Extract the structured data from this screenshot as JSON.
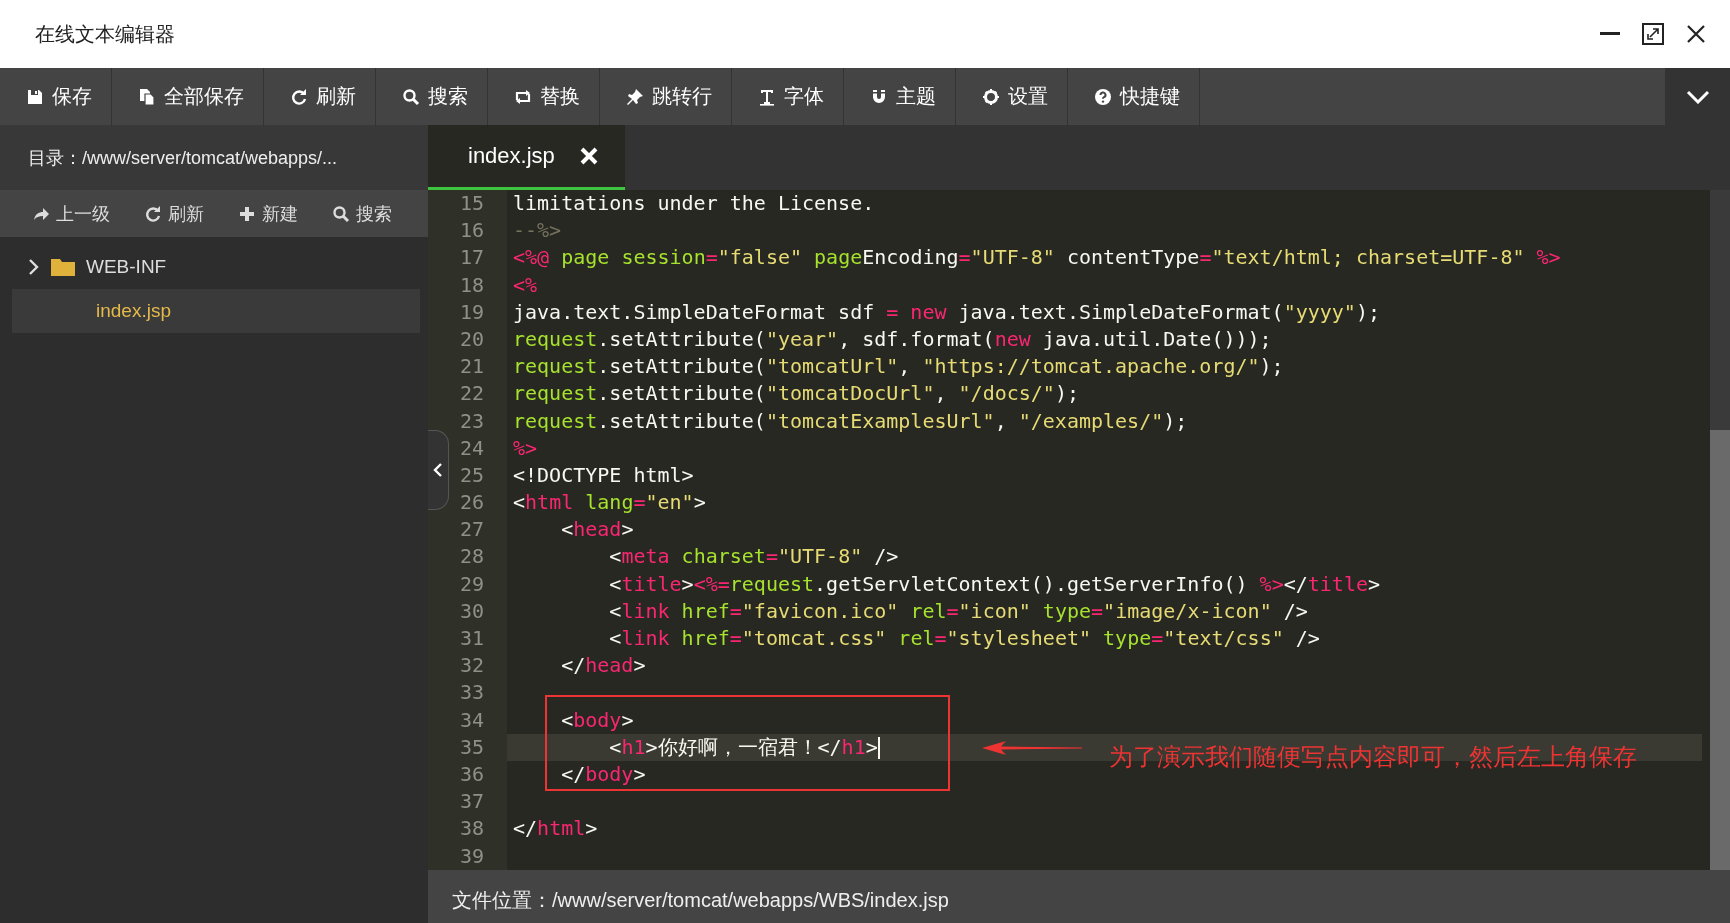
{
  "window": {
    "title": "在线文本编辑器"
  },
  "toolbar": [
    "保存",
    "全部保存",
    "刷新",
    "搜索",
    "替换",
    "跳转行",
    "字体",
    "主题",
    "设置",
    "快捷键"
  ],
  "sidebar": {
    "path": "目录：/www/server/tomcat/webapps/...",
    "actions": [
      "上一级",
      "刷新",
      "新建",
      "搜索"
    ],
    "tree": [
      {
        "kind": "folder",
        "name": "WEB-INF",
        "expanded": false,
        "selected": false
      },
      {
        "kind": "file",
        "name": "index.jsp",
        "selected": true
      }
    ]
  },
  "tabs": [
    {
      "label": "index.jsp",
      "selected": true
    }
  ],
  "editor": {
    "lines": [
      {
        "number": "15",
        "current": false,
        "tokens": [
          {
            "kind": "plain",
            "text": "limitations under the License."
          }
        ]
      },
      {
        "number": "16",
        "current": false,
        "tokens": [
          {
            "kind": "comment",
            "text": "--%>"
          }
        ]
      },
      {
        "number": "17",
        "current": false,
        "tokens": [
          {
            "kind": "tag",
            "text": "<%@"
          },
          {
            "kind": "attr",
            "text": " page"
          },
          {
            "kind": "attr",
            "text": " session"
          },
          {
            "kind": "tag",
            "text": "="
          },
          {
            "kind": "string",
            "text": "\"false\""
          },
          {
            "kind": "attr",
            "text": " page"
          },
          {
            "kind": "plain",
            "text": "Encoding"
          },
          {
            "kind": "tag",
            "text": "="
          },
          {
            "kind": "string",
            "text": "\"UTF-8\""
          },
          {
            "kind": "plain",
            "text": " contentType"
          },
          {
            "kind": "tag",
            "text": "="
          },
          {
            "kind": "string",
            "text": "\"text/html; charset=UTF-8\""
          },
          {
            "kind": "tag",
            "text": " %>"
          }
        ]
      },
      {
        "number": "18",
        "current": false,
        "tokens": [
          {
            "kind": "tag",
            "text": "<%"
          }
        ]
      },
      {
        "number": "19",
        "current": false,
        "tokens": [
          {
            "kind": "plain",
            "text": "java.text.SimpleDateFormat sdf "
          },
          {
            "kind": "tag",
            "text": "="
          },
          {
            "kind": "tag",
            "text": " new"
          },
          {
            "kind": "plain",
            "text": " java.text.SimpleDateFormat("
          },
          {
            "kind": "string",
            "text": "\"yyyy\""
          },
          {
            "kind": "plain",
            "text": ");"
          }
        ]
      },
      {
        "number": "20",
        "current": false,
        "tokens": [
          {
            "kind": "attr",
            "text": "request"
          },
          {
            "kind": "plain",
            "text": ".setAttribute("
          },
          {
            "kind": "string",
            "text": "\"year\""
          },
          {
            "kind": "plain",
            "text": ", sdf.format("
          },
          {
            "kind": "tag",
            "text": "new"
          },
          {
            "kind": "plain",
            "text": " java.util.Date()));"
          }
        ]
      },
      {
        "number": "21",
        "current": false,
        "tokens": [
          {
            "kind": "attr",
            "text": "request"
          },
          {
            "kind": "plain",
            "text": ".setAttribute("
          },
          {
            "kind": "string",
            "text": "\"tomcatUrl\""
          },
          {
            "kind": "plain",
            "text": ", "
          },
          {
            "kind": "string",
            "text": "\"https://tomcat.apache.org/\""
          },
          {
            "kind": "plain",
            "text": ");"
          }
        ]
      },
      {
        "number": "22",
        "current": false,
        "tokens": [
          {
            "kind": "attr",
            "text": "request"
          },
          {
            "kind": "plain",
            "text": ".setAttribute("
          },
          {
            "kind": "string",
            "text": "\"tomcatDocUrl\""
          },
          {
            "kind": "plain",
            "text": ", "
          },
          {
            "kind": "string",
            "text": "\"/docs/\""
          },
          {
            "kind": "plain",
            "text": ");"
          }
        ]
      },
      {
        "number": "23",
        "current": false,
        "tokens": [
          {
            "kind": "attr",
            "text": "request"
          },
          {
            "kind": "plain",
            "text": ".setAttribute("
          },
          {
            "kind": "string",
            "text": "\"tomcatExamplesUrl\""
          },
          {
            "kind": "plain",
            "text": ", "
          },
          {
            "kind": "string",
            "text": "\"/examples/\""
          },
          {
            "kind": "plain",
            "text": ");"
          }
        ]
      },
      {
        "number": "24",
        "current": false,
        "tokens": [
          {
            "kind": "tag",
            "text": "%>"
          }
        ]
      },
      {
        "number": "25",
        "current": false,
        "tokens": [
          {
            "kind": "plain",
            "text": "<!DOCTYPE html>"
          }
        ]
      },
      {
        "number": "26",
        "current": false,
        "tokens": [
          {
            "kind": "plain",
            "text": "<"
          },
          {
            "kind": "tag",
            "text": "html"
          },
          {
            "kind": "attr",
            "text": " lang"
          },
          {
            "kind": "tag",
            "text": "="
          },
          {
            "kind": "string",
            "text": "\"en\""
          },
          {
            "kind": "plain",
            "text": ">"
          }
        ]
      },
      {
        "number": "27",
        "current": false,
        "tokens": [
          {
            "kind": "plain",
            "text": "    <"
          },
          {
            "kind": "tag",
            "text": "head"
          },
          {
            "kind": "plain",
            "text": ">"
          }
        ]
      },
      {
        "number": "28",
        "current": false,
        "tokens": [
          {
            "kind": "plain",
            "text": "        <"
          },
          {
            "kind": "tag",
            "text": "meta"
          },
          {
            "kind": "attr",
            "text": " charset"
          },
          {
            "kind": "tag",
            "text": "="
          },
          {
            "kind": "string",
            "text": "\"UTF-8\""
          },
          {
            "kind": "plain",
            "text": " />"
          }
        ]
      },
      {
        "number": "29",
        "current": false,
        "tokens": [
          {
            "kind": "plain",
            "text": "        <"
          },
          {
            "kind": "tag",
            "text": "title"
          },
          {
            "kind": "plain",
            "text": ">"
          },
          {
            "kind": "tag",
            "text": "<%="
          },
          {
            "kind": "attr",
            "text": "request"
          },
          {
            "kind": "plain",
            "text": ".getServletContext().getServerInfo() "
          },
          {
            "kind": "tag",
            "text": "%>"
          },
          {
            "kind": "plain",
            "text": "</"
          },
          {
            "kind": "tag",
            "text": "title"
          },
          {
            "kind": "plain",
            "text": ">"
          }
        ]
      },
      {
        "number": "30",
        "current": false,
        "tokens": [
          {
            "kind": "plain",
            "text": "        <"
          },
          {
            "kind": "tag",
            "text": "link"
          },
          {
            "kind": "attr",
            "text": " href"
          },
          {
            "kind": "tag",
            "text": "="
          },
          {
            "kind": "string",
            "text": "\"favicon.ico\""
          },
          {
            "kind": "attr",
            "text": " rel"
          },
          {
            "kind": "tag",
            "text": "="
          },
          {
            "kind": "string",
            "text": "\"icon\""
          },
          {
            "kind": "attr",
            "text": " type"
          },
          {
            "kind": "tag",
            "text": "="
          },
          {
            "kind": "string",
            "text": "\"image/x-icon\""
          },
          {
            "kind": "plain",
            "text": " />"
          }
        ]
      },
      {
        "number": "31",
        "current": false,
        "tokens": [
          {
            "kind": "plain",
            "text": "        <"
          },
          {
            "kind": "tag",
            "text": "link"
          },
          {
            "kind": "attr",
            "text": " href"
          },
          {
            "kind": "tag",
            "text": "="
          },
          {
            "kind": "string",
            "text": "\"tomcat.css\""
          },
          {
            "kind": "attr",
            "text": " rel"
          },
          {
            "kind": "tag",
            "text": "="
          },
          {
            "kind": "string",
            "text": "\"stylesheet\""
          },
          {
            "kind": "attr",
            "text": " type"
          },
          {
            "kind": "tag",
            "text": "="
          },
          {
            "kind": "string",
            "text": "\"text/css\""
          },
          {
            "kind": "plain",
            "text": " />"
          }
        ]
      },
      {
        "number": "32",
        "current": false,
        "tokens": [
          {
            "kind": "plain",
            "text": "    </"
          },
          {
            "kind": "tag",
            "text": "head"
          },
          {
            "kind": "plain",
            "text": ">"
          }
        ]
      },
      {
        "number": "33",
        "current": false
      },
      {
        "number": "34",
        "current": false,
        "tokens": [
          {
            "kind": "plain",
            "text": "    <"
          },
          {
            "kind": "tag",
            "text": "body"
          },
          {
            "kind": "plain",
            "text": ">"
          }
        ]
      },
      {
        "number": "35",
        "current": true,
        "tokens": [
          {
            "kind": "plain",
            "text": "        <"
          },
          {
            "kind": "tag",
            "text": "h1"
          },
          {
            "kind": "plain",
            "text": ">你好啊，一宿君！</"
          },
          {
            "kind": "tag",
            "text": "h1"
          },
          {
            "kind": "plain",
            "text": ">"
          }
        ]
      },
      {
        "number": "36",
        "current": false,
        "tokens": [
          {
            "kind": "plain",
            "text": "    </"
          },
          {
            "kind": "tag",
            "text": "body"
          },
          {
            "kind": "plain",
            "text": ">"
          }
        ]
      },
      {
        "number": "37",
        "current": false
      },
      {
        "number": "38",
        "current": false,
        "tokens": [
          {
            "kind": "plain",
            "text": "</"
          },
          {
            "kind": "tag",
            "text": "html"
          },
          {
            "kind": "plain",
            "text": ">"
          }
        ]
      },
      {
        "number": "39",
        "current": false
      }
    ]
  },
  "annotation": {
    "note": "为了演示我们随便写点内容即可，然后左上角保存"
  },
  "status_bar": {
    "text": "文件位置：/www/server/tomcat/webapps/WBS/index.jsp"
  }
}
